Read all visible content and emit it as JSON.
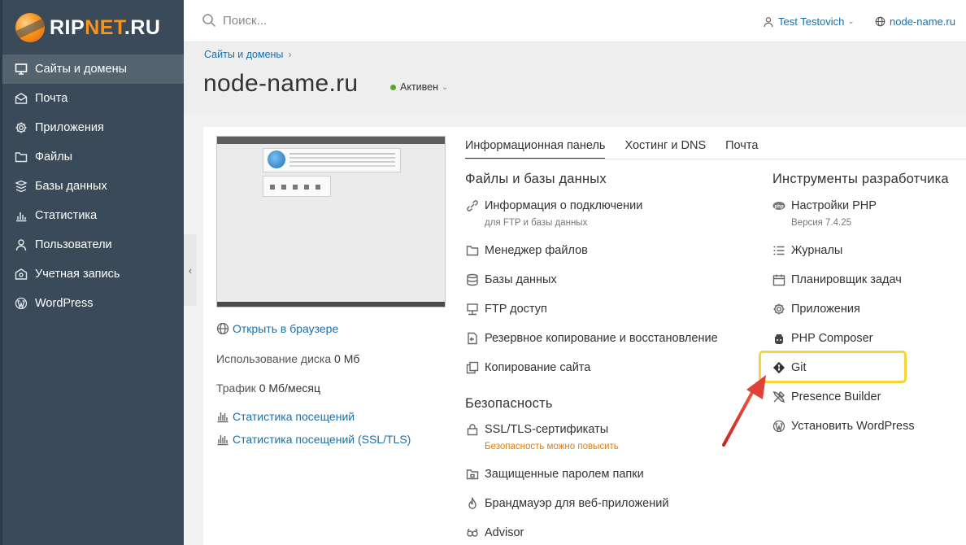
{
  "brand": {
    "prefix": "RIP",
    "middle": "NET",
    "suffix": ".RU"
  },
  "search": {
    "placeholder": "Поиск..."
  },
  "user": {
    "name": "Test Testovich"
  },
  "domain_link": "node-name.ru",
  "sidebar": {
    "items": [
      {
        "label": "Сайты и домены",
        "icon": "monitor-icon",
        "active": true
      },
      {
        "label": "Почта",
        "icon": "mail-icon"
      },
      {
        "label": "Приложения",
        "icon": "gear-icon"
      },
      {
        "label": "Файлы",
        "icon": "folder-icon"
      },
      {
        "label": "Базы данных",
        "icon": "database-icon"
      },
      {
        "label": "Статистика",
        "icon": "chart-icon"
      },
      {
        "label": "Пользователи",
        "icon": "user-icon"
      },
      {
        "label": "Учетная запись",
        "icon": "account-icon"
      },
      {
        "label": "WordPress",
        "icon": "wordpress-icon"
      }
    ]
  },
  "breadcrumb": {
    "label": "Сайты и домены"
  },
  "page": {
    "title": "node-name.ru",
    "status": "Активен"
  },
  "left": {
    "open_browser": "Открыть в браузере",
    "disk_label": "Использование диска",
    "disk_value": "0 Мб",
    "traffic_label": "Трафик",
    "traffic_value": "0 Мб/месяц",
    "stats": "Статистика посещений",
    "stats_ssl": "Статистика посещений (SSL/TLS)"
  },
  "tabs": [
    {
      "label": "Информационная панель",
      "active": true
    },
    {
      "label": "Хостинг и DNS"
    },
    {
      "label": "Почта"
    }
  ],
  "files_section": {
    "title": "Файлы и базы данных",
    "items": [
      {
        "label": "Информация о подключении",
        "sub": "для FTP и базы данных",
        "icon": "connection-icon"
      },
      {
        "label": "Менеджер файлов",
        "icon": "folder-icon"
      },
      {
        "label": "Базы данных",
        "icon": "database-icon"
      },
      {
        "label": "FTP доступ",
        "icon": "ftp-icon"
      },
      {
        "label": "Резервное копирование и восстановление",
        "icon": "backup-icon"
      },
      {
        "label": "Копирование сайта",
        "icon": "copy-icon"
      }
    ]
  },
  "security_section": {
    "title": "Безопасность",
    "items": [
      {
        "label": "SSL/TLS-сертификаты",
        "sub": "Безопасность можно повысить",
        "icon": "lock-icon"
      },
      {
        "label": "Защищенные паролем папки",
        "icon": "protected-folder-icon"
      },
      {
        "label": "Брандмауэр для веб-приложений",
        "icon": "flame-icon"
      },
      {
        "label": "Advisor",
        "icon": "advisor-icon"
      }
    ]
  },
  "dev_section": {
    "title": "Инструменты разработчика",
    "items": [
      {
        "label": "Настройки PHP",
        "sub": "Версия 7.4.25",
        "icon": "php-icon"
      },
      {
        "label": "Журналы",
        "icon": "list-icon"
      },
      {
        "label": "Планировщик задач",
        "icon": "calendar-icon"
      },
      {
        "label": "Приложения",
        "icon": "gear-icon"
      },
      {
        "label": "PHP Composer",
        "icon": "composer-icon"
      },
      {
        "label": "Git",
        "icon": "git-icon",
        "highlighted": true
      },
      {
        "label": "Presence Builder",
        "icon": "tools-icon"
      },
      {
        "label": "Установить WordPress",
        "icon": "wordpress-icon"
      }
    ]
  },
  "colors": {
    "sidebar": "#3a4a59",
    "link": "#1b6fa8",
    "status": "#5aa62b",
    "warning": "#e07b12",
    "highlight": "#f5d53c",
    "arrow": "#d9302c"
  }
}
